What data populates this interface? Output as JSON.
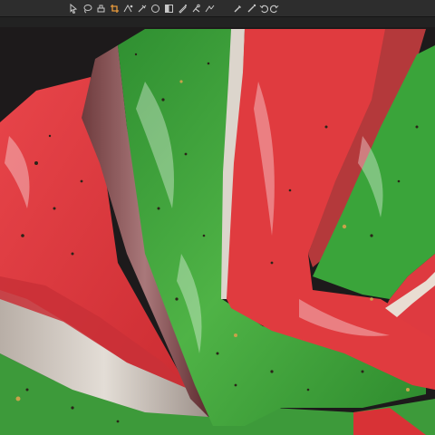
{
  "toolbar": {
    "left_tools": [
      {
        "icon": "select-tool-icon",
        "active": false
      },
      {
        "icon": "lasso-tool-icon",
        "active": false
      },
      {
        "icon": "brush-tool-icon",
        "active": false
      },
      {
        "icon": "crop-tool-icon",
        "active": true
      },
      {
        "icon": "transform-tool-icon",
        "active": false
      },
      {
        "icon": "color-picker-icon",
        "active": false
      },
      {
        "icon": "gradient-tool-icon",
        "active": false
      },
      {
        "icon": "shape-tool-icon",
        "active": false
      },
      {
        "icon": "pen-tool-icon",
        "active": false
      },
      {
        "icon": "eraser-tool-icon",
        "active": false
      },
      {
        "icon": "text-tool-icon",
        "active": false
      }
    ],
    "right_tools": [
      {
        "icon": "pipette-tool-icon"
      },
      {
        "icon": "heal-tool-icon"
      },
      {
        "icon": "undo-icon"
      },
      {
        "icon": "redo-icon"
      }
    ],
    "icon_color": "#c8c8c8",
    "active_color": "#e89a3c"
  },
  "canvas": {
    "background": "#1d1a1b",
    "palette": {
      "red": "#e23a3c",
      "red_dark": "#9e2124",
      "green": "#3fa63a",
      "green_dark": "#1f6b22",
      "rind": "#cfc9c0",
      "rind_dark": "#8d7f78"
    }
  }
}
